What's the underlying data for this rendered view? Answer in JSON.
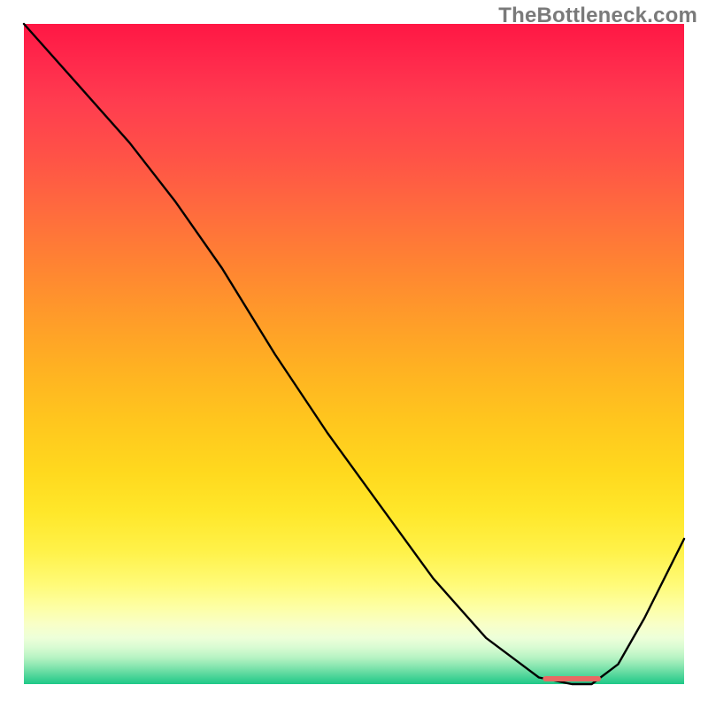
{
  "watermark": "TheBottleneck.com",
  "chart_data": {
    "type": "line",
    "title": "",
    "xlabel": "",
    "ylabel": "",
    "xlim": [
      0,
      100
    ],
    "ylim": [
      0,
      100
    ],
    "grid": false,
    "legend": false,
    "series": [
      {
        "name": "bottleneck-curve",
        "x": [
          0,
          8,
          16,
          23,
          30,
          38,
          46,
          54,
          62,
          70,
          78,
          83,
          86,
          90,
          94,
          100
        ],
        "values": [
          100,
          91,
          82,
          73,
          63,
          50,
          38,
          27,
          16,
          7,
          1,
          0,
          0,
          3,
          10,
          22
        ]
      }
    ],
    "marker": {
      "x_start": 79,
      "x_end": 87,
      "y": 0.8,
      "color": "#e86a63",
      "stroke_width": 6
    }
  }
}
